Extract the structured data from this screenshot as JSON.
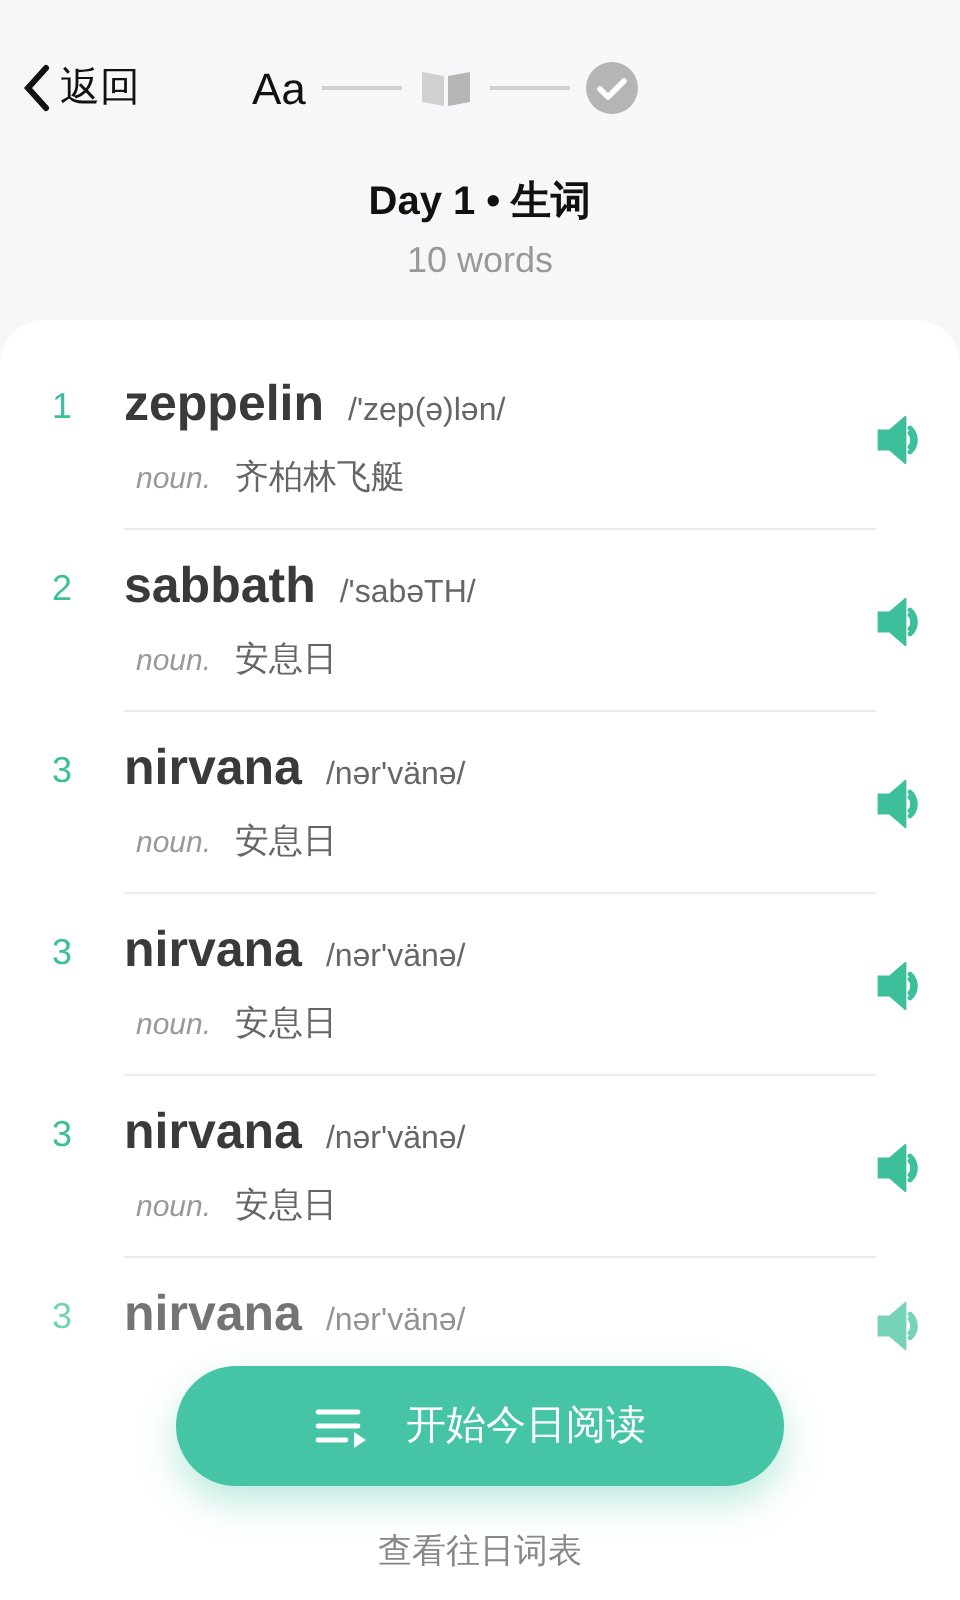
{
  "nav": {
    "back_label": "返回"
  },
  "steps": [
    {
      "kind": "font",
      "label": "Aa",
      "active": true
    },
    {
      "kind": "book",
      "active": false
    },
    {
      "kind": "check",
      "active": false
    }
  ],
  "header": {
    "title": "Day 1 • 生词",
    "subtitle": "10 words"
  },
  "words": [
    {
      "number": "1",
      "word": "zeppelin",
      "phonetic": "/'zep(ə)lən/",
      "pos": "noun.",
      "definition": "齐柏林飞艇",
      "faded": false
    },
    {
      "number": "2",
      "word": "sabbath",
      "phonetic": "/'sabəTH/",
      "pos": "noun.",
      "definition": "安息日",
      "faded": false
    },
    {
      "number": "3",
      "word": "nirvana",
      "phonetic": "/nər'vänə/",
      "pos": "noun.",
      "definition": "安息日",
      "faded": false
    },
    {
      "number": "3",
      "word": "nirvana",
      "phonetic": "/nər'vänə/",
      "pos": "noun.",
      "definition": "安息日",
      "faded": false
    },
    {
      "number": "3",
      "word": "nirvana",
      "phonetic": "/nər'vänə/",
      "pos": "noun.",
      "definition": "安息日",
      "faded": false
    },
    {
      "number": "3",
      "word": "nirvana",
      "phonetic": "/nər'vänə/",
      "faded": true
    }
  ],
  "start_button": "开始今日阅读",
  "history_link": "查看往日词表"
}
